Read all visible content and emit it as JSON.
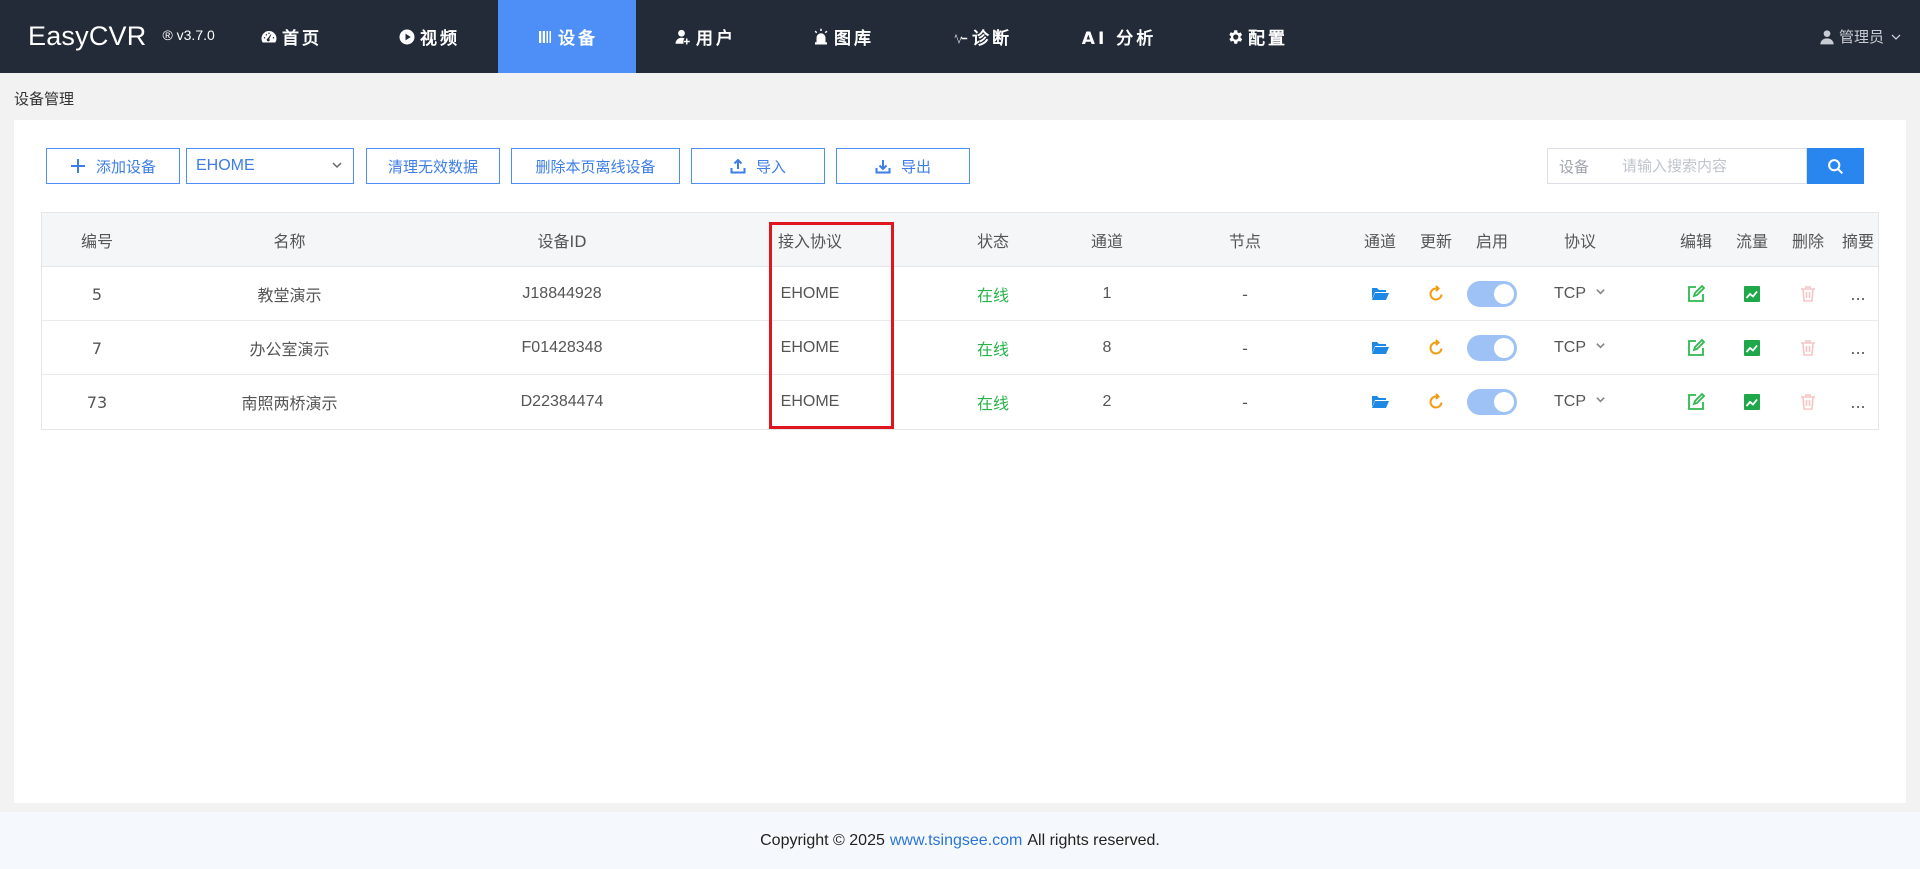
{
  "brand": {
    "name": "EasyCVR",
    "version": "® v3.7.0"
  },
  "nav": {
    "items": [
      {
        "label": "首页",
        "icon": "dashboard-icon",
        "active": false
      },
      {
        "label": "视频",
        "icon": "play-icon",
        "active": false
      },
      {
        "label": "设备",
        "icon": "device-icon",
        "active": true
      },
      {
        "label": "用户",
        "icon": "user-add-icon",
        "active": false
      },
      {
        "label": "图库",
        "icon": "alarm-icon",
        "active": false
      },
      {
        "label": "诊断",
        "icon": "pulse-icon",
        "active": false
      },
      {
        "label": "AI 分析",
        "icon": "",
        "active": false
      },
      {
        "label": "配置",
        "icon": "gear-icon",
        "active": false
      }
    ],
    "user": "管理员"
  },
  "breadcrumb": "设备管理",
  "toolbar": {
    "add_label": "添加设备",
    "filter_value": "EHOME",
    "clean_label": "清理无效数据",
    "delete_offline_label": "删除本页离线设备",
    "import_label": "导入",
    "export_label": "导出",
    "search_prefix": "设备",
    "search_placeholder": "请输入搜索内容"
  },
  "table": {
    "headers": [
      "编号",
      "名称",
      "设备ID",
      "接入协议",
      "状态",
      "通道",
      "节点",
      "通道",
      "更新",
      "启用",
      "协议",
      "编辑",
      "流量",
      "删除",
      "摘要"
    ],
    "rows": [
      {
        "id": "5",
        "name": "教堂演示",
        "device_id": "J18844928",
        "protocol": "EHOME",
        "status": "在线",
        "channels": "1",
        "node": "-",
        "transport": "TCP",
        "summary": "..."
      },
      {
        "id": "7",
        "name": "办公室演示",
        "device_id": "F01428348",
        "protocol": "EHOME",
        "status": "在线",
        "channels": "8",
        "node": "-",
        "transport": "TCP",
        "summary": "..."
      },
      {
        "id": "73",
        "name": "南照两桥演示",
        "device_id": "D22384474",
        "protocol": "EHOME",
        "status": "在线",
        "channels": "2",
        "node": "-",
        "transport": "TCP",
        "summary": "..."
      }
    ]
  },
  "footer": {
    "prefix": "Copyright © 2025",
    "link": "www.tsingsee.com",
    "suffix": "All rights reserved."
  },
  "colors": {
    "nav_bg": "#232b38",
    "accent": "#4d8ef7",
    "online": "#27b34a",
    "highlight": "#e0161f"
  }
}
